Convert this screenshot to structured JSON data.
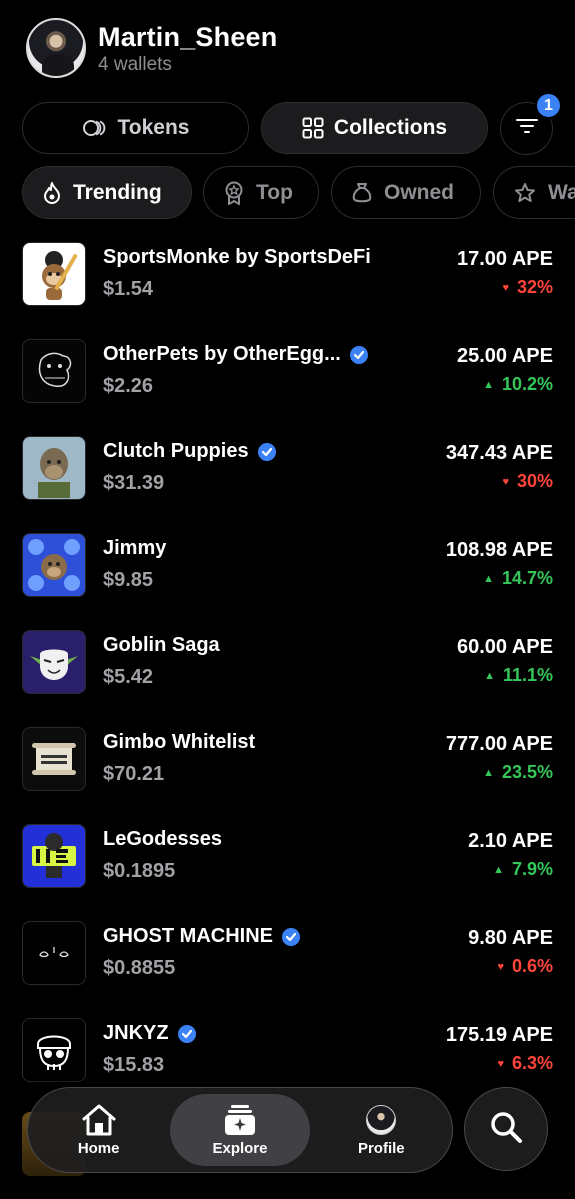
{
  "header": {
    "name": "Martin_Sheen",
    "subtitle": "4 wallets"
  },
  "segments": {
    "tokens": "Tokens",
    "collections": "Collections",
    "filter_badge": "1"
  },
  "chips": {
    "trending": "Trending",
    "top": "Top",
    "owned": "Owned",
    "watchlist": "Wa"
  },
  "collections": [
    {
      "name": "SportsMonke by SportsDeFi",
      "usd": "$1.54",
      "price": "17.00 APE",
      "change": "32%",
      "direction": "down",
      "verified": false
    },
    {
      "name": "OtherPets by OtherEgg...",
      "usd": "$2.26",
      "price": "25.00 APE",
      "change": "10.2%",
      "direction": "up",
      "verified": true
    },
    {
      "name": "Clutch Puppies",
      "usd": "$31.39",
      "price": "347.43 APE",
      "change": "30%",
      "direction": "down",
      "verified": true
    },
    {
      "name": "Jimmy",
      "usd": "$9.85",
      "price": "108.98 APE",
      "change": "14.7%",
      "direction": "up",
      "verified": false
    },
    {
      "name": "Goblin Saga",
      "usd": "$5.42",
      "price": "60.00 APE",
      "change": "11.1%",
      "direction": "up",
      "verified": false
    },
    {
      "name": "Gimbo Whitelist",
      "usd": "$70.21",
      "price": "777.00 APE",
      "change": "23.5%",
      "direction": "up",
      "verified": false
    },
    {
      "name": "LeGodesses",
      "usd": "$0.1895",
      "price": "2.10 APE",
      "change": "7.9%",
      "direction": "up",
      "verified": false
    },
    {
      "name": "GHOST MACHINE",
      "usd": "$0.8855",
      "price": "9.80 APE",
      "change": "0.6%",
      "direction": "down",
      "verified": true
    },
    {
      "name": "JNKYZ",
      "usd": "$15.83",
      "price": "175.19 APE",
      "change": "6.3%",
      "direction": "down",
      "verified": true
    }
  ],
  "nav": {
    "home": "Home",
    "explore": "Explore",
    "profile": "Profile"
  },
  "colors": {
    "up": "#34c759",
    "down": "#ff453a",
    "verified": "#3b82f6",
    "badge": "#3b82f6"
  }
}
